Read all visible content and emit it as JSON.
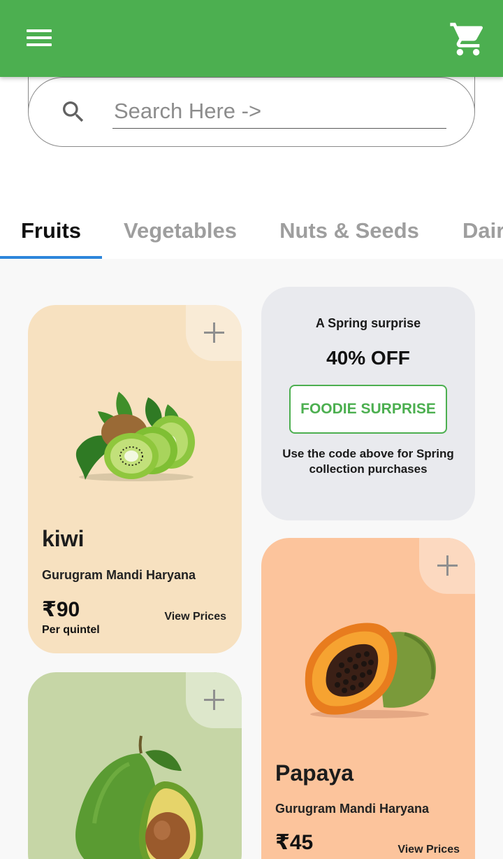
{
  "header": {
    "menu_icon": "menu-icon",
    "cart_icon": "shopping-cart-icon",
    "color": "#4caf50"
  },
  "search": {
    "placeholder": "Search Here ->",
    "icon": "search-icon"
  },
  "tabs": [
    {
      "label": "Fruits",
      "active": true
    },
    {
      "label": "Vegetables",
      "active": false
    },
    {
      "label": "Nuts & Seeds",
      "active": false
    },
    {
      "label": "Dair",
      "active": false
    }
  ],
  "tab_indicator_color": "#2d86db",
  "promo": {
    "title": "A Spring surprise",
    "discount": "40% OFF",
    "code": "FOODIE SURPRISE",
    "note": "Use the code above for Spring collection purchases"
  },
  "products": [
    {
      "name": "kiwi",
      "location": "Gurugram Mandi Haryana",
      "price": "₹90",
      "unit": "Per quintel",
      "action": "View Prices",
      "image": "kiwi-image",
      "bg_color": "#f7e1c0"
    },
    {
      "name": "Papaya",
      "location": "Gurugram Mandi Haryana",
      "price": "₹45",
      "action": "View Prices",
      "image": "papaya-image",
      "bg_color": "#fcc49c"
    },
    {
      "image": "avocado-image",
      "bg_color": "#c6d6a6"
    }
  ]
}
